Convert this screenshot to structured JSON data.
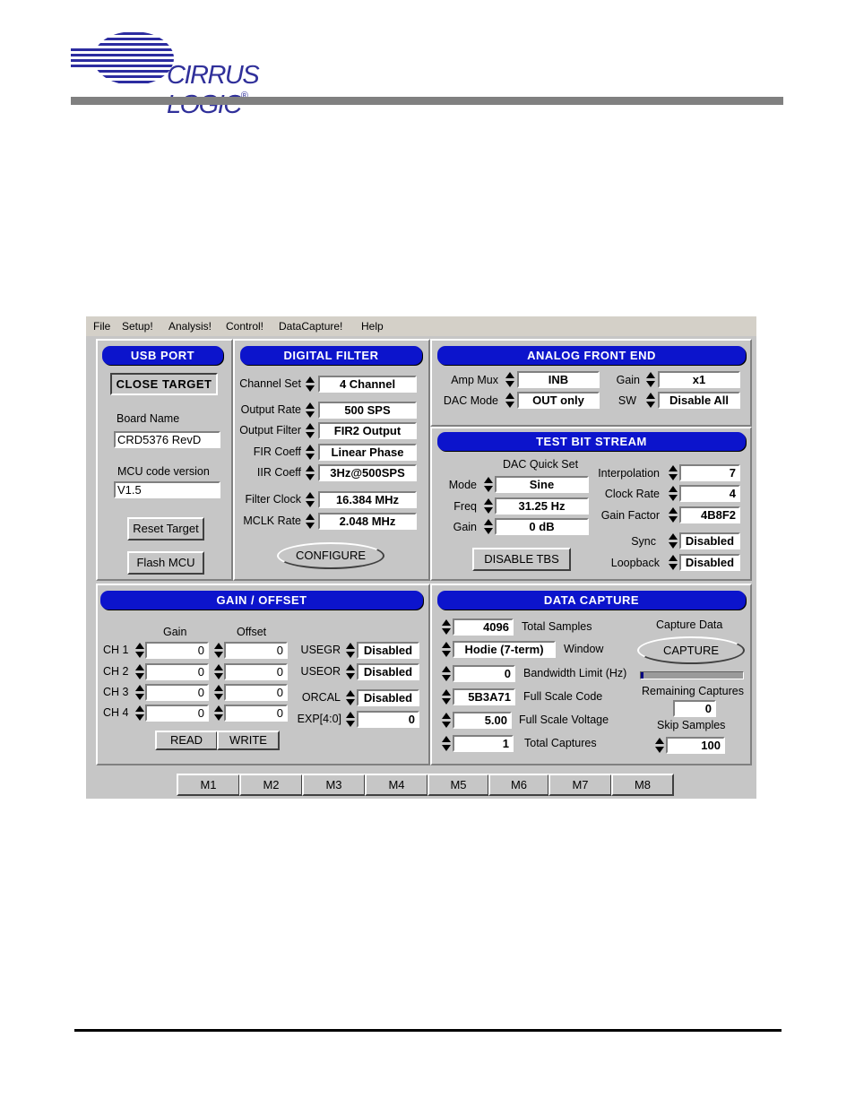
{
  "header": {
    "brand": "CIRRUS LOGIC",
    "trademark": "®"
  },
  "app": {
    "menu": [
      "File",
      "Setup!",
      "Analysis!",
      "Control!",
      "DataCapture!",
      "Help"
    ],
    "usb_port": {
      "title": "USB PORT",
      "close_target": "CLOSE TARGET",
      "board_name_label": "Board Name",
      "board_name": "CRD5376 RevD",
      "mcu_version_label": "MCU code version",
      "mcu_version": "V1.5",
      "reset_target": "Reset Target",
      "flash_mcu": "Flash MCU"
    },
    "digital_filter": {
      "title": "DIGITAL FILTER",
      "rows": [
        {
          "label": "Channel Set",
          "value": "4 Channel"
        },
        {
          "label": "Output Rate",
          "value": "500 SPS"
        },
        {
          "label": "Output Filter",
          "value": "FIR2 Output"
        },
        {
          "label": "FIR Coeff",
          "value": "Linear Phase"
        },
        {
          "label": "IIR Coeff",
          "value": "3Hz@500SPS"
        },
        {
          "label": "Filter Clock",
          "value": "16.384 MHz"
        },
        {
          "label": "MCLK Rate",
          "value": "2.048 MHz"
        }
      ],
      "configure": "CONFIGURE"
    },
    "analog_front_end": {
      "title": "ANALOG FRONT END",
      "amp_mux_label": "Amp Mux",
      "amp_mux": "INB",
      "dac_mode_label": "DAC Mode",
      "dac_mode": "OUT only",
      "gain_label": "Gain",
      "gain": "x1",
      "sw_label": "SW",
      "sw": "Disable All"
    },
    "test_bit_stream": {
      "title": "TEST BIT STREAM",
      "dac_quick_set": "DAC Quick Set",
      "mode_label": "Mode",
      "mode": "Sine",
      "freq_label": "Freq",
      "freq": "31.25 Hz",
      "gain_label": "Gain",
      "gain": "0 dB",
      "interpolation_label": "Interpolation",
      "interpolation": "7",
      "clock_rate_label": "Clock Rate",
      "clock_rate": "4",
      "gain_factor_label": "Gain Factor",
      "gain_factor": "4B8F2",
      "sync_label": "Sync",
      "sync": "Disabled",
      "loopback_label": "Loopback",
      "loopback": "Disabled",
      "disable_tbs": "DISABLE TBS"
    },
    "gain_offset": {
      "title": "GAIN / OFFSET",
      "gain_header": "Gain",
      "offset_header": "Offset",
      "channels": [
        {
          "label": "CH 1",
          "gain": "0",
          "offset": "0"
        },
        {
          "label": "CH 2",
          "gain": "0",
          "offset": "0"
        },
        {
          "label": "CH 3",
          "gain": "0",
          "offset": "0"
        },
        {
          "label": "CH 4",
          "gain": "0",
          "offset": "0"
        }
      ],
      "usegr_label": "USEGR",
      "usegr": "Disabled",
      "useor_label": "USEOR",
      "useor": "Disabled",
      "orcal_label": "ORCAL",
      "orcal": "Disabled",
      "exp_label": "EXP[4:0]",
      "exp": "0",
      "read": "READ",
      "write": "WRITE"
    },
    "data_capture": {
      "title": "DATA CAPTURE",
      "total_samples_label": "Total Samples",
      "total_samples": "4096",
      "window_label": "Window",
      "window": "Hodie (7-term)",
      "bandwidth_label": "Bandwidth Limit (Hz)",
      "bandwidth": "0",
      "full_scale_code_label": "Full Scale Code",
      "full_scale_code": "5B3A71",
      "full_scale_voltage_label": "Full Scale Voltage",
      "full_scale_voltage": "5.00",
      "total_captures_label": "Total Captures",
      "total_captures": "1",
      "capture_data_label": "Capture Data",
      "capture": "CAPTURE",
      "progress": 0.03,
      "remaining_label": "Remaining Captures",
      "remaining": "0",
      "skip_label": "Skip Samples",
      "skip": "100"
    },
    "macros": [
      "M1",
      "M2",
      "M3",
      "M4",
      "M5",
      "M6",
      "M7",
      "M8"
    ]
  },
  "colors": {
    "title_bar": "#0c14cc",
    "logo": "#2c2ca0",
    "window_bg": "#c6c6c6"
  }
}
